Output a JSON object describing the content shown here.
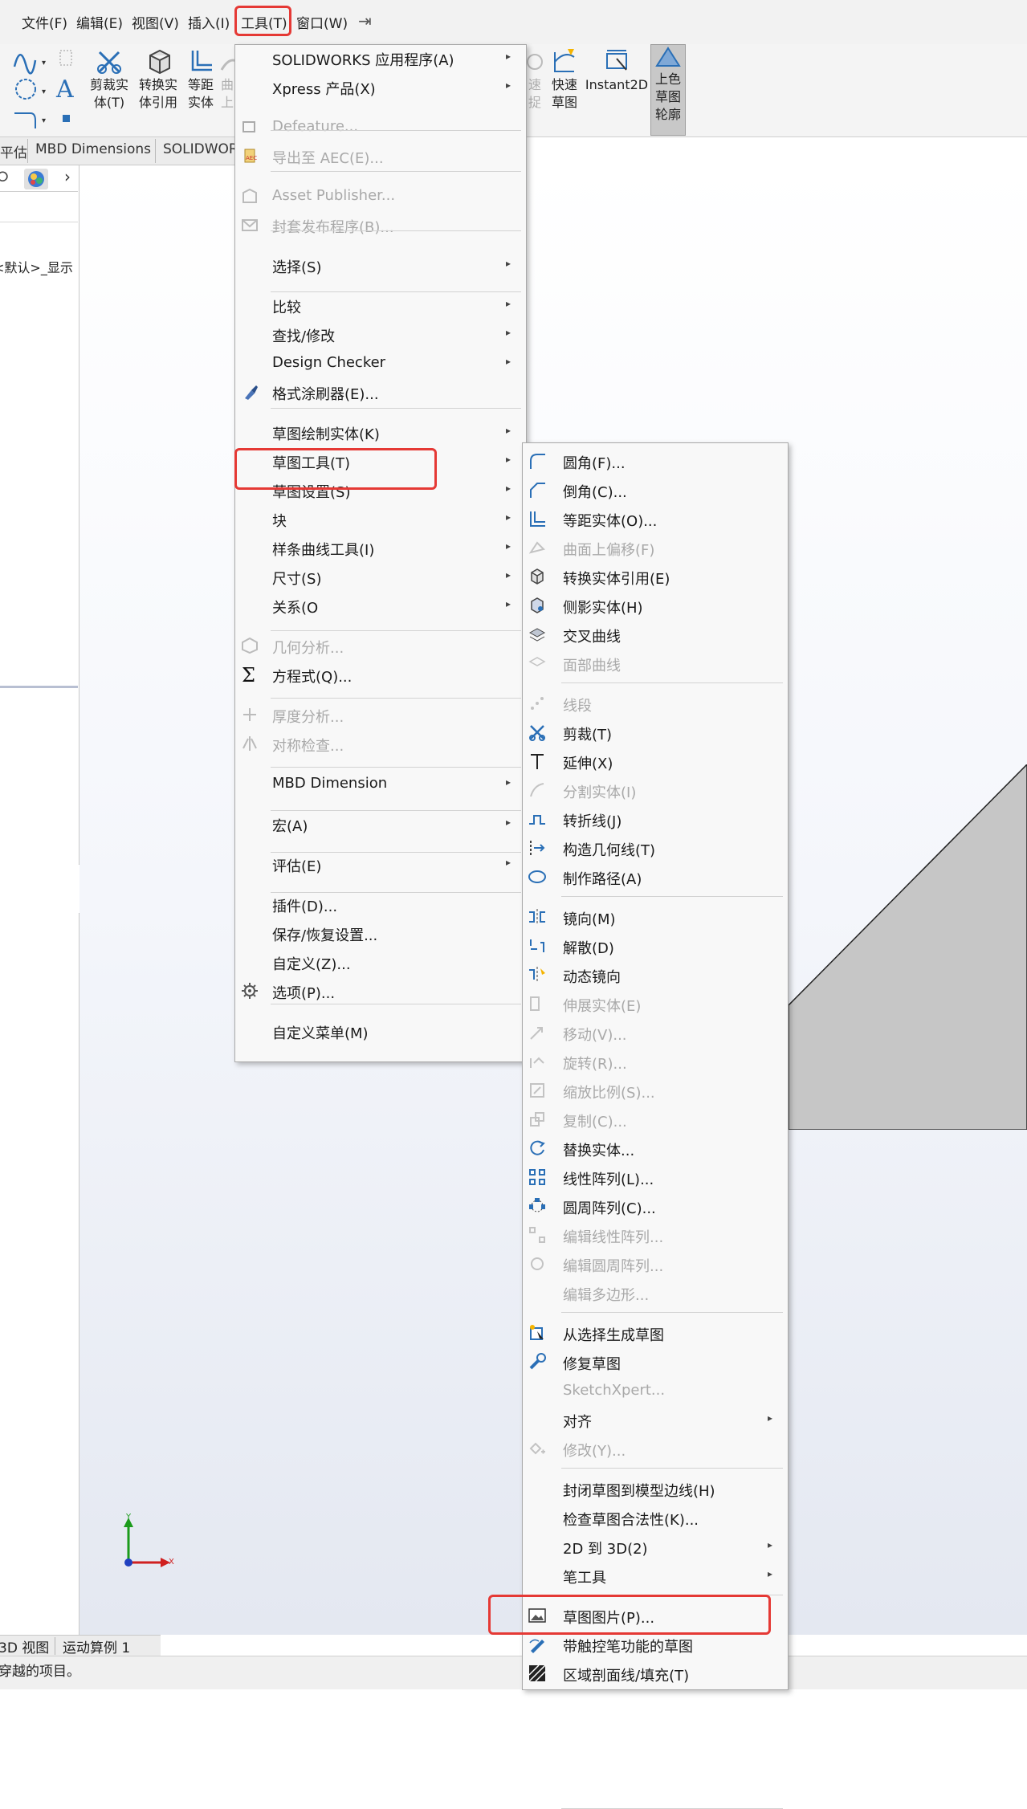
{
  "menubar": {
    "items": [
      "文件(F)",
      "编辑(E)",
      "视图(V)",
      "插入(I)",
      "工具(T)",
      "窗口(W)"
    ]
  },
  "toolbar": {
    "trim": [
      "剪裁实",
      "体(T)"
    ],
    "convert": [
      "转换实",
      "体引用"
    ],
    "offset": [
      "等距",
      "实体"
    ],
    "curve": [
      "曲",
      "上"
    ],
    "rapid": [
      "速",
      "捉"
    ],
    "quick_sketch": [
      "快速",
      "草图"
    ],
    "instant2d": "Instant2D",
    "shaded_sketch": [
      "上色",
      "草图",
      "轮廓"
    ]
  },
  "tabs": {
    "items": [
      "平估",
      "MBD Dimensions",
      "SOLIDWOR"
    ]
  },
  "left_panel": {
    "config_text": "<默认>_显示",
    "bottom_tabs": [
      "3D 视图",
      "运动算例 1"
    ]
  },
  "status_bar": {
    "text": "穿越的项目。"
  },
  "axis": {
    "x": "X",
    "y": "Y"
  },
  "tools_menu": {
    "items": [
      {
        "label": "SOLIDWORKS 应用程序(A)",
        "submenu": true,
        "disabled": false,
        "icon": ""
      },
      {
        "label": "Xpress 产品(X)",
        "submenu": true,
        "disabled": false,
        "icon": ""
      },
      {
        "label": "Defeature...",
        "submenu": false,
        "disabled": true,
        "icon": "defeature-icon"
      },
      {
        "label": "导出至 AEC(E)...",
        "submenu": false,
        "disabled": true,
        "icon": "export-aec-icon"
      },
      {
        "label": "Asset Publisher...",
        "submenu": false,
        "disabled": true,
        "icon": "asset-publisher-icon"
      },
      {
        "label": "封套发布程序(B)...",
        "submenu": false,
        "disabled": true,
        "icon": "envelope-publisher-icon"
      },
      {
        "label": "选择(S)",
        "submenu": true,
        "disabled": false,
        "icon": ""
      },
      {
        "label": "比较",
        "submenu": true,
        "disabled": false,
        "icon": ""
      },
      {
        "label": "查找/修改",
        "submenu": true,
        "disabled": false,
        "icon": ""
      },
      {
        "label": "Design Checker",
        "submenu": true,
        "disabled": false,
        "icon": ""
      },
      {
        "label": "格式涂刷器(E)...",
        "submenu": false,
        "disabled": false,
        "icon": "format-painter-icon"
      },
      {
        "label": "草图绘制实体(K)",
        "submenu": true,
        "disabled": false,
        "icon": ""
      },
      {
        "label": "草图工具(T)",
        "submenu": true,
        "disabled": false,
        "icon": ""
      },
      {
        "label": "草图设置(S)",
        "submenu": true,
        "disabled": false,
        "icon": ""
      },
      {
        "label": "块",
        "submenu": true,
        "disabled": false,
        "icon": ""
      },
      {
        "label": "样条曲线工具(I)",
        "submenu": true,
        "disabled": false,
        "icon": ""
      },
      {
        "label": "尺寸(S)",
        "submenu": true,
        "disabled": false,
        "icon": ""
      },
      {
        "label": "关系(O",
        "submenu": true,
        "disabled": false,
        "icon": ""
      },
      {
        "label": "几何分析...",
        "submenu": false,
        "disabled": true,
        "icon": "geometry-analysis-icon"
      },
      {
        "label": "方程式(Q)...",
        "submenu": false,
        "disabled": false,
        "icon": "sigma-icon"
      },
      {
        "label": "厚度分析...",
        "submenu": false,
        "disabled": true,
        "icon": "thickness-analysis-icon"
      },
      {
        "label": "对称检查...",
        "submenu": false,
        "disabled": true,
        "icon": "symmetry-check-icon"
      },
      {
        "label": "MBD Dimension",
        "submenu": true,
        "disabled": false,
        "icon": ""
      },
      {
        "label": "宏(A)",
        "submenu": true,
        "disabled": false,
        "icon": ""
      },
      {
        "label": "评估(E)",
        "submenu": true,
        "disabled": false,
        "icon": ""
      },
      {
        "label": "插件(D)...",
        "submenu": false,
        "disabled": false,
        "icon": ""
      },
      {
        "label": "保存/恢复设置...",
        "submenu": false,
        "disabled": false,
        "icon": ""
      },
      {
        "label": "自定义(Z)...",
        "submenu": false,
        "disabled": false,
        "icon": ""
      },
      {
        "label": "选项(P)...",
        "submenu": false,
        "disabled": false,
        "icon": "gear-icon"
      },
      {
        "label": "自定义菜单(M)",
        "submenu": false,
        "disabled": false,
        "icon": ""
      }
    ]
  },
  "sketch_tools_menu": {
    "items": [
      {
        "label": "圆角(F)...",
        "submenu": false,
        "disabled": false,
        "icon": "fillet-icon"
      },
      {
        "label": "倒角(C)...",
        "submenu": false,
        "disabled": false,
        "icon": "chamfer-icon"
      },
      {
        "label": "等距实体(O)...",
        "submenu": false,
        "disabled": false,
        "icon": "offset-entities-icon"
      },
      {
        "label": "曲面上偏移(F)",
        "submenu": false,
        "disabled": true,
        "icon": "offset-on-surface-icon"
      },
      {
        "label": "转换实体引用(E)",
        "submenu": false,
        "disabled": false,
        "icon": "convert-entities-icon"
      },
      {
        "label": "侧影实体(H)",
        "submenu": false,
        "disabled": false,
        "icon": "silhouette-icon"
      },
      {
        "label": "交叉曲线",
        "submenu": false,
        "disabled": false,
        "icon": "intersection-curve-icon"
      },
      {
        "label": "面部曲线",
        "submenu": false,
        "disabled": true,
        "icon": "face-curves-icon"
      },
      {
        "label": "线段",
        "submenu": false,
        "disabled": true,
        "icon": "segment-icon"
      },
      {
        "label": "剪裁(T)",
        "submenu": false,
        "disabled": false,
        "icon": "trim-icon"
      },
      {
        "label": "延伸(X)",
        "submenu": false,
        "disabled": false,
        "icon": "extend-icon"
      },
      {
        "label": "分割实体(I)",
        "submenu": false,
        "disabled": true,
        "icon": "split-entities-icon"
      },
      {
        "label": "转折线(J)",
        "submenu": false,
        "disabled": false,
        "icon": "jog-line-icon"
      },
      {
        "label": "构造几何线(T)",
        "submenu": false,
        "disabled": false,
        "icon": "construction-geometry-icon"
      },
      {
        "label": "制作路径(A)",
        "submenu": false,
        "disabled": false,
        "icon": "make-path-icon"
      },
      {
        "label": "镜向(M)",
        "submenu": false,
        "disabled": false,
        "icon": "mirror-icon"
      },
      {
        "label": "解散(D)",
        "submenu": false,
        "disabled": false,
        "icon": "explode-icon"
      },
      {
        "label": "动态镜向",
        "submenu": false,
        "disabled": false,
        "icon": "dynamic-mirror-icon"
      },
      {
        "label": "伸展实体(E)",
        "submenu": false,
        "disabled": true,
        "icon": "stretch-entities-icon"
      },
      {
        "label": "移动(V)...",
        "submenu": false,
        "disabled": true,
        "icon": "move-icon"
      },
      {
        "label": "旋转(R)...",
        "submenu": false,
        "disabled": true,
        "icon": "rotate-icon"
      },
      {
        "label": "缩放比例(S)...",
        "submenu": false,
        "disabled": true,
        "icon": "scale-icon"
      },
      {
        "label": "复制(C)...",
        "submenu": false,
        "disabled": true,
        "icon": "copy-icon"
      },
      {
        "label": "替换实体...",
        "submenu": false,
        "disabled": false,
        "icon": "replace-entity-icon"
      },
      {
        "label": "线性阵列(L)...",
        "submenu": false,
        "disabled": false,
        "icon": "linear-pattern-icon"
      },
      {
        "label": "圆周阵列(C)...",
        "submenu": false,
        "disabled": false,
        "icon": "circular-pattern-icon"
      },
      {
        "label": "编辑线性阵列...",
        "submenu": false,
        "disabled": true,
        "icon": "edit-linear-pattern-icon"
      },
      {
        "label": "编辑圆周阵列...",
        "submenu": false,
        "disabled": true,
        "icon": "edit-circular-pattern-icon"
      },
      {
        "label": "编辑多边形...",
        "submenu": false,
        "disabled": true,
        "icon": ""
      },
      {
        "label": "从选择生成草图",
        "submenu": false,
        "disabled": false,
        "icon": "sketch-from-selections-icon"
      },
      {
        "label": "修复草图",
        "submenu": false,
        "disabled": false,
        "icon": "repair-sketch-icon"
      },
      {
        "label": "SketchXpert...",
        "submenu": false,
        "disabled": true,
        "icon": ""
      },
      {
        "label": "对齐",
        "submenu": true,
        "disabled": false,
        "icon": ""
      },
      {
        "label": "修改(Y)...",
        "submenu": false,
        "disabled": true,
        "icon": "modify-icon"
      },
      {
        "label": "封闭草图到模型边线(H)",
        "submenu": false,
        "disabled": false,
        "icon": ""
      },
      {
        "label": "检查草图合法性(K)...",
        "submenu": false,
        "disabled": false,
        "icon": ""
      },
      {
        "label": "2D 到 3D(2)",
        "submenu": true,
        "disabled": false,
        "icon": ""
      },
      {
        "label": "笔工具",
        "submenu": true,
        "disabled": false,
        "icon": ""
      },
      {
        "label": "草图图片(P)...",
        "submenu": false,
        "disabled": false,
        "icon": "sketch-picture-icon"
      },
      {
        "label": "带触控笔功能的草图",
        "submenu": false,
        "disabled": false,
        "icon": "pen-sketch-icon"
      },
      {
        "label": "区域剖面线/填充(T)",
        "submenu": false,
        "disabled": false,
        "icon": "area-hatch-icon"
      }
    ]
  }
}
